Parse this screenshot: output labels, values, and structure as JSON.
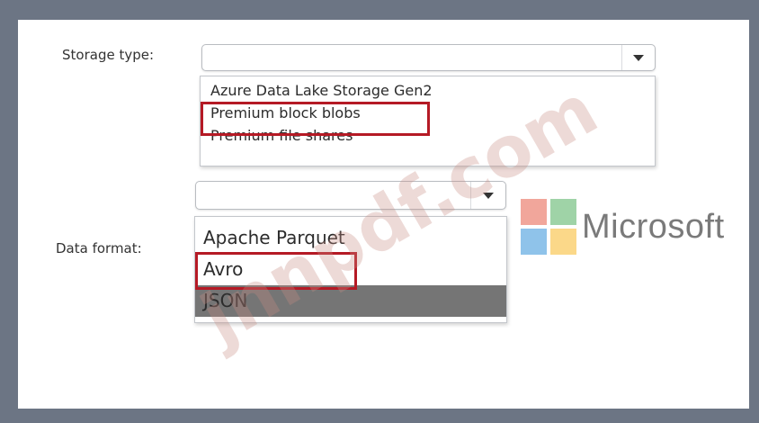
{
  "storage": {
    "label": "Storage type:",
    "selected_value": "",
    "options": [
      {
        "label": "Azure Data Lake Storage Gen2",
        "highlighted": false
      },
      {
        "label": "Premium block blobs",
        "highlighted": true
      },
      {
        "label": "Premium file shares",
        "highlighted": false
      }
    ]
  },
  "format": {
    "label": "Data format:",
    "selected_value": "",
    "options": [
      {
        "label": "Apache Parquet",
        "highlighted": false,
        "selected": false
      },
      {
        "label": "Avro",
        "highlighted": true,
        "selected": false
      },
      {
        "label": "JSON",
        "highlighted": false,
        "selected": true
      }
    ]
  },
  "branding": {
    "logo_icon": "microsoft-logo-icon",
    "logo_text": "Microsoft",
    "logo_colors": [
      "#f1a69b",
      "#9fd3a7",
      "#8fc3ea",
      "#fbd889"
    ]
  },
  "watermark": {
    "text": "jnnpdf.com"
  },
  "colors": {
    "highlight_border": "#b51a25",
    "selected_row": "#757575",
    "frame": "#6c7584"
  }
}
